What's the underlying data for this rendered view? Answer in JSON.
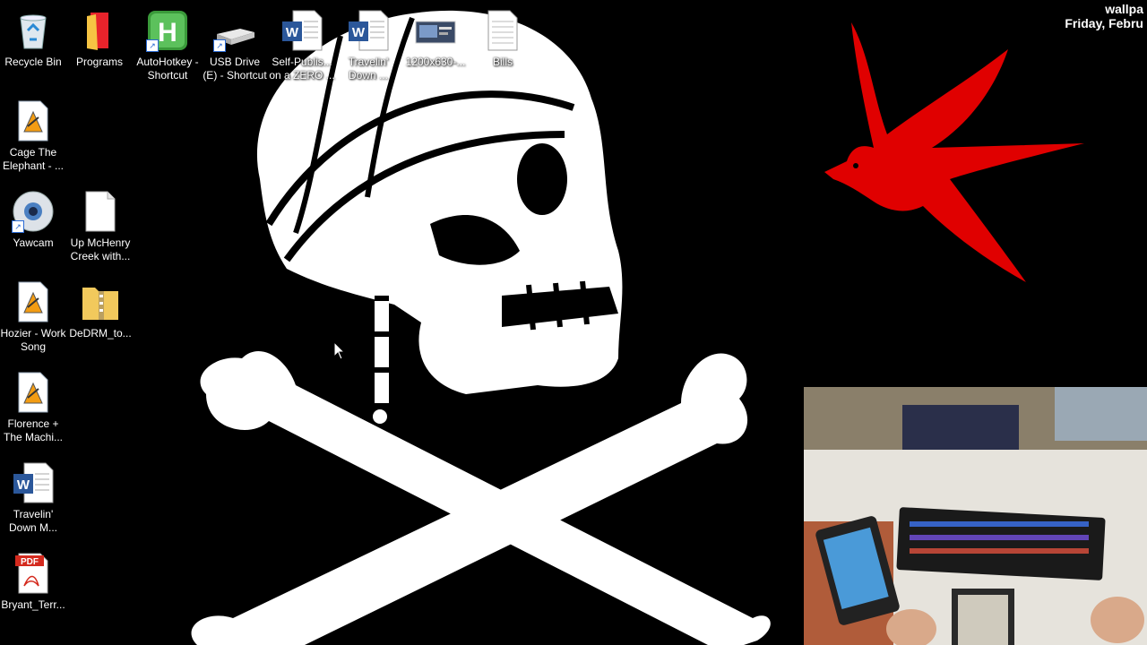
{
  "overlay": {
    "line1": "wallpa",
    "line2": "Friday, Febru"
  },
  "desktop_icons": [
    {
      "label": "Recycle Bin",
      "icon": "recycle-bin-icon"
    },
    {
      "label": "Programs",
      "icon": "folder-red-icon"
    },
    {
      "label": "AutoHotkey - Shortcut",
      "icon": "autohotkey-icon"
    },
    {
      "label": "USB Drive (E) - Shortcut",
      "icon": "usb-drive-icon"
    },
    {
      "label": "Self-Publis... on a ZERO ...",
      "icon": "word-doc-icon"
    },
    {
      "label": "Travelin' Down ...",
      "icon": "word-doc-icon"
    },
    {
      "label": "1200x630-...",
      "icon": "image-file-icon"
    },
    {
      "label": "Bills",
      "icon": "text-file-icon"
    },
    {
      "label": "Cage The Elephant - ...",
      "icon": "vlc-media-icon"
    },
    {
      "label": "Yawcam",
      "icon": "yawcam-icon"
    },
    {
      "label": "Up McHenry Creek with...",
      "icon": "blank-file-icon"
    },
    {
      "label": "Hozier - Work Song",
      "icon": "vlc-media-icon"
    },
    {
      "label": "DeDRM_to...",
      "icon": "zip-folder-icon"
    },
    {
      "label": "Florence + The Machi...",
      "icon": "vlc-media-icon"
    },
    {
      "label": "Travelin' Down M...",
      "icon": "word-doc-icon"
    },
    {
      "label": "Bryant_Terr...",
      "icon": "pdf-icon"
    }
  ],
  "pdf_badge": "PDF",
  "colors": {
    "background": "#000000",
    "skull": "#ffffff",
    "swallow": "#e00000",
    "word_blue": "#2b579a"
  }
}
